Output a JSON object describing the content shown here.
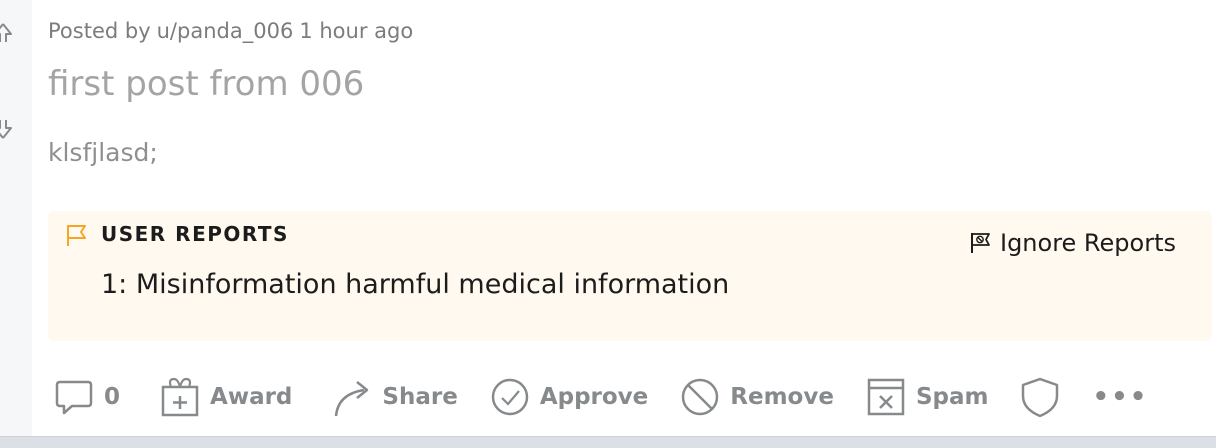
{
  "post": {
    "meta_prefix": "Posted by",
    "author": "u/panda_006",
    "time": "1 hour ago",
    "title": "first post from 006",
    "body": "klsfjlasd;"
  },
  "reports": {
    "heading": "USER REPORTS",
    "ignore_label": "Ignore Reports",
    "items": [
      "1: Misinformation harmful medical information"
    ],
    "flag_color": "#f5a623",
    "background": "#fff9f0"
  },
  "actions": {
    "comments_count": "0",
    "award_label": "Award",
    "share_label": "Share",
    "approve_label": "Approve",
    "remove_label": "Remove",
    "spam_label": "Spam",
    "more_label": "•••"
  },
  "icons": {
    "vote": [
      "upvote-icon",
      "downvote-icon"
    ],
    "actions": [
      "comment-icon",
      "award-icon",
      "share-icon",
      "approve-icon",
      "remove-icon",
      "spam-icon",
      "shield-icon",
      "more-icon"
    ]
  }
}
